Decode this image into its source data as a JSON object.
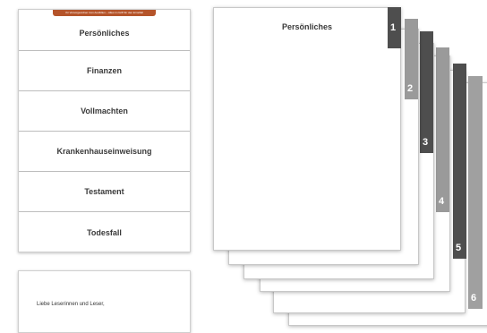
{
  "index_card": {
    "banner": "Ihr Vorsorgeordner zum Ausfüllen – Alles im Griff für den Ernstfall",
    "items": [
      {
        "label": "Persönliches"
      },
      {
        "label": "Finanzen"
      },
      {
        "label": "Vollmachten"
      },
      {
        "label": "Krankenhauseinweisung"
      },
      {
        "label": "Testament"
      },
      {
        "label": "Todesfall"
      }
    ]
  },
  "letter": {
    "greeting": "Liebe Leserinnen und Leser,"
  },
  "pages": {
    "front_title": "Persönliches",
    "tabs": [
      "1",
      "2",
      "3",
      "4",
      "5",
      "6"
    ]
  },
  "colors": {
    "banner": "#b5542a",
    "tab_dark": "#4e4e4e",
    "tab_light": "#9a9a9a"
  }
}
